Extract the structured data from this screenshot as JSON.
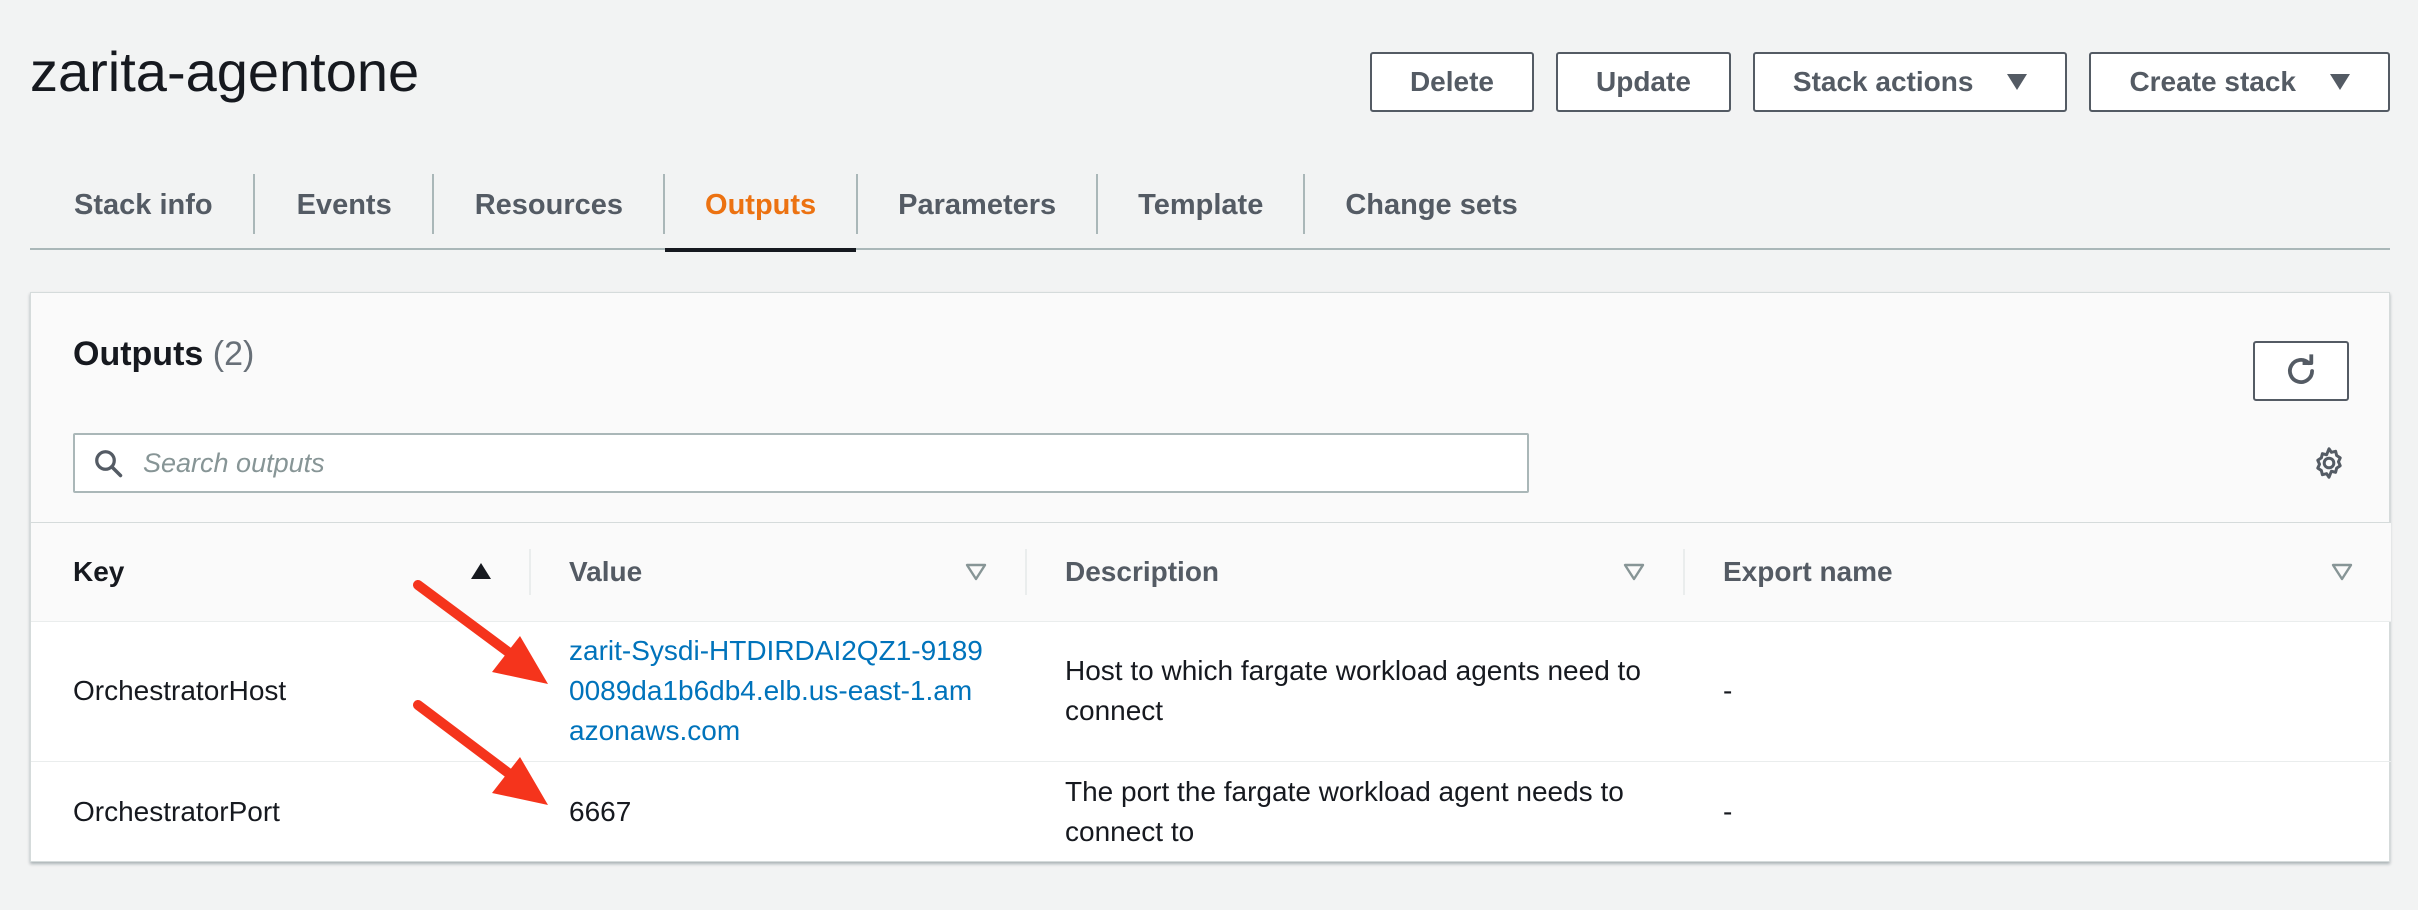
{
  "stack": {
    "title": "zarita-agentone"
  },
  "actions": {
    "delete_label": "Delete",
    "update_label": "Update",
    "stack_actions_label": "Stack actions",
    "create_stack_label": "Create stack"
  },
  "tabs": [
    {
      "label": "Stack info"
    },
    {
      "label": "Events"
    },
    {
      "label": "Resources"
    },
    {
      "label": "Outputs",
      "active": true
    },
    {
      "label": "Parameters"
    },
    {
      "label": "Template"
    },
    {
      "label": "Change sets"
    }
  ],
  "outputs": {
    "title": "Outputs",
    "count": "(2)",
    "search_placeholder": "Search outputs",
    "columns": {
      "key": "Key",
      "value": "Value",
      "description": "Description",
      "export_name": "Export name"
    },
    "rows": [
      {
        "key": "OrchestratorHost",
        "value": "zarit-Sysdi-HTDIRDAI2QZ1-91890089da1b6db4.elb.us-east-1.amazonaws.com",
        "description": "Host to which fargate workload agents need to connect",
        "export_name": "-"
      },
      {
        "key": "OrchestratorPort",
        "value": "6667",
        "description": "The port the fargate workload agent needs to connect to",
        "export_name": "-"
      }
    ]
  },
  "colors": {
    "accent_orange": "#ec7211",
    "link_blue": "#0073bb",
    "annotation_red": "#f5341c"
  },
  "icons": {
    "refresh": "refresh-icon",
    "search": "search-icon",
    "settings": "gear-icon",
    "sort_ascending": "sort-ascending-icon",
    "sort_filter": "sort-filter-icon",
    "annotation_arrow": "red-arrow-icon"
  }
}
